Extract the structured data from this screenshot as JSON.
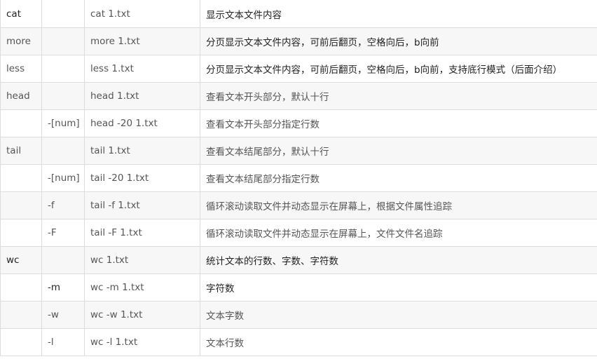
{
  "rows": [
    {
      "command": "cat",
      "option": "",
      "example": "cat 1.txt",
      "description": "显示文本文件内容"
    },
    {
      "command": "more",
      "option": "",
      "example": "more 1.txt",
      "description": "分页显示文本文件内容，可前后翻页，空格向后，b向前"
    },
    {
      "command": "less",
      "option": "",
      "example": "less 1.txt",
      "description": "分页显示文本文件内容，可前后翻页，空格向后，b向前，支持底行模式（后面介绍）"
    },
    {
      "command": "head",
      "option": "",
      "example": "head 1.txt",
      "description": "查看文本开头部分，默认十行"
    },
    {
      "command": "",
      "option": "-[num]",
      "example": "head -20 1.txt",
      "description": "查看文本开头部分指定行数"
    },
    {
      "command": "tail",
      "option": "",
      "example": "tail 1.txt",
      "description": "查看文本结尾部分，默认十行"
    },
    {
      "command": "",
      "option": "-[num]",
      "example": "tail -20 1.txt",
      "description": "查看文本结尾部分指定行数"
    },
    {
      "command": "",
      "option": "-f",
      "example": "tail -f 1.txt",
      "description": "循环滚动读取文件并动态显示在屏幕上，根据文件属性追踪"
    },
    {
      "command": "",
      "option": "-F",
      "example": "tail -F 1.txt",
      "description": "循环滚动读取文件并动态显示在屏幕上，文件文件名追踪"
    },
    {
      "command": "wc",
      "option": "",
      "example": "wc 1.txt",
      "description": "统计文本的行数、字数、字符数"
    },
    {
      "command": "",
      "option": "-m",
      "example": "wc -m 1.txt",
      "description": "字符数"
    },
    {
      "command": "",
      "option": "-w",
      "example": "wc -w 1.txt",
      "description": "文本字数"
    },
    {
      "command": "",
      "option": "-l",
      "example": "wc -l 1.txt",
      "description": "文本行数"
    }
  ]
}
